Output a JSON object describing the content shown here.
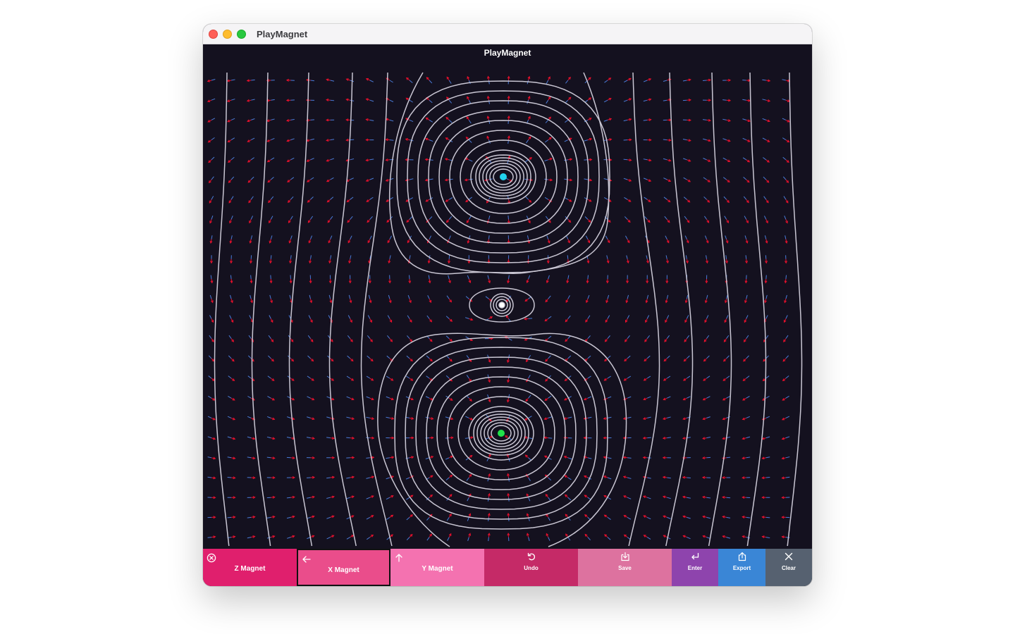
{
  "window": {
    "title": "PlayMagnet"
  },
  "app": {
    "title": "PlayMagnet"
  },
  "magnets": [
    {
      "name": "top",
      "color": "#22d3ee"
    },
    {
      "name": "center",
      "color": "#ffffff"
    },
    {
      "name": "bottom",
      "color": "#22e04a"
    }
  ],
  "field_colors": {
    "arrow_head": "#e8112d",
    "arrow_tail": "#4a7bd8",
    "field_line": "#c9c6d3",
    "background": "#14111f"
  },
  "toolbar": {
    "z_magnet": {
      "label": "Z Magnet",
      "icon": "circle-x-icon",
      "color": "#e01f6d"
    },
    "x_magnet": {
      "label": "X Magnet",
      "icon": "arrow-left-icon",
      "color": "#ea4d8b"
    },
    "y_magnet": {
      "label": "Y Magnet",
      "icon": "arrow-up-icon",
      "color": "#f472b0"
    },
    "undo": {
      "label": "Undo",
      "icon": "undo-icon",
      "color": "#c52a67"
    },
    "save": {
      "label": "Save",
      "icon": "save-icon",
      "color": "#dd729f"
    },
    "enter": {
      "label": "Enter",
      "icon": "enter-icon",
      "color": "#8e44ad"
    },
    "export": {
      "label": "Export",
      "icon": "share-icon",
      "color": "#3a86d6"
    },
    "clear": {
      "label": "Clear",
      "icon": "close-icon",
      "color": "#566170"
    }
  }
}
